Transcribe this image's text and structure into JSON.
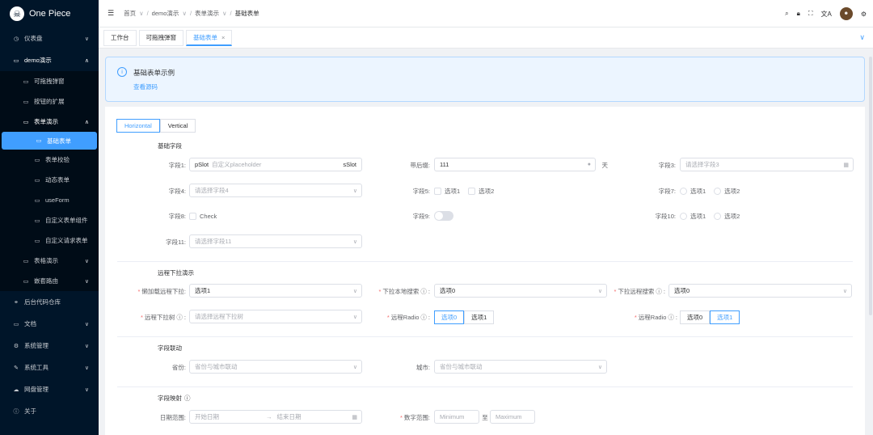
{
  "app": {
    "title": "One Piece",
    "logo_mark": "☠"
  },
  "sidebar": {
    "items": [
      {
        "label": "仪表盘",
        "icon": "dashboard-icon",
        "arrow": "∨"
      },
      {
        "label": "demo演示",
        "icon": "monitor-icon",
        "arrow": "∧"
      },
      {
        "label": "可拖拽弹窗",
        "icon": "monitor-icon"
      },
      {
        "label": "按钮的扩展",
        "icon": "monitor-icon"
      },
      {
        "label": "表单演示",
        "icon": "monitor-icon",
        "arrow": "∧"
      },
      {
        "label": "基础表单",
        "icon": "monitor-icon"
      },
      {
        "label": "表单校验",
        "icon": "monitor-icon"
      },
      {
        "label": "动态表单",
        "icon": "monitor-icon"
      },
      {
        "label": "useForm",
        "icon": "monitor-icon"
      },
      {
        "label": "自定义表单组件",
        "icon": "monitor-icon"
      },
      {
        "label": "自定义请求表单",
        "icon": "monitor-icon"
      },
      {
        "label": "表格演示",
        "icon": "monitor-icon",
        "arrow": "∨"
      },
      {
        "label": "嵌套路由",
        "icon": "monitor-icon",
        "arrow": "∨"
      },
      {
        "label": "后台代码仓库",
        "icon": "link-icon"
      },
      {
        "label": "文档",
        "icon": "monitor-icon",
        "arrow": "∨"
      },
      {
        "label": "系统管理",
        "icon": "gear-icon",
        "arrow": "∨"
      },
      {
        "label": "系统工具",
        "icon": "tool-icon",
        "arrow": "∨"
      },
      {
        "label": "网盘管理",
        "icon": "cloud-icon",
        "arrow": "∨"
      },
      {
        "label": "关于",
        "icon": "info-icon"
      }
    ]
  },
  "header": {
    "breadcrumb": [
      "首页",
      "demo演示",
      "表单演示",
      "基础表单"
    ],
    "icons": [
      "search-icon",
      "lock-icon",
      "fullscreen-icon",
      "translate-icon",
      "avatar",
      "gear-icon"
    ]
  },
  "tabs": [
    {
      "label": "工作台"
    },
    {
      "label": "可拖拽弹窗"
    },
    {
      "label": "基础表单",
      "close": "×"
    }
  ],
  "alert": {
    "title": "基础表单示例",
    "link": "查看源码"
  },
  "layout_switch": {
    "options": [
      "Horizontal",
      "Vertical"
    ],
    "selected": "Horizontal"
  },
  "form": {
    "sections": [
      "基础字段",
      "远程下拉演示",
      "字段联动",
      "字段映射"
    ],
    "f1": {
      "label": "字段1:",
      "prefix": "pSlot",
      "placeholder": "自定义placeholder",
      "suffix": "sSlot"
    },
    "f2": {
      "label": "带后缀:",
      "value": "111",
      "unit": "天"
    },
    "f3": {
      "label": "字段3:",
      "placeholder": "请选择字段3"
    },
    "f4": {
      "label": "字段4:",
      "placeholder": "请选择字段4"
    },
    "f5": {
      "label": "字段5:",
      "options": [
        "选项1",
        "选项2"
      ]
    },
    "f7": {
      "label": "字段7:",
      "options": [
        "选项1",
        "选项2"
      ]
    },
    "f8": {
      "label": "字段8:",
      "option": "Check"
    },
    "f9": {
      "label": "字段9:"
    },
    "f10": {
      "label": "字段10:",
      "options": [
        "选项1",
        "选项2"
      ]
    },
    "f11": {
      "label": "字段11:",
      "placeholder": "请选择字段11"
    },
    "r1": {
      "label": "懒加载远程下拉:",
      "value": "选项1"
    },
    "r2": {
      "label": "下拉本地搜索",
      "value": "选项0"
    },
    "r3": {
      "label": "下拉远程搜索",
      "value": "选项0"
    },
    "r4": {
      "label": "远程下拉树",
      "placeholder": "请选择远程下拉树"
    },
    "r5": {
      "label": "远程Radio",
      "options": [
        "选项0",
        "选项1"
      ],
      "selected": "选项0"
    },
    "r6": {
      "label": "远程Radio",
      "options": [
        "选项0",
        "选项1"
      ],
      "selected": "选项1"
    },
    "l1": {
      "label": "省份:",
      "placeholder": "省份与城市联动"
    },
    "l2": {
      "label": "城市:",
      "placeholder": "省份与城市联动"
    },
    "m1": {
      "label": "日期范围:",
      "start": "开始日期",
      "end": "结束日期",
      "arrow": "→"
    },
    "m2": {
      "label": "数字范围:",
      "min": "Minimum",
      "to": "至",
      "max": "Maximum"
    }
  },
  "colors": {
    "primary": "#409eff",
    "sidebar": "#001529"
  }
}
